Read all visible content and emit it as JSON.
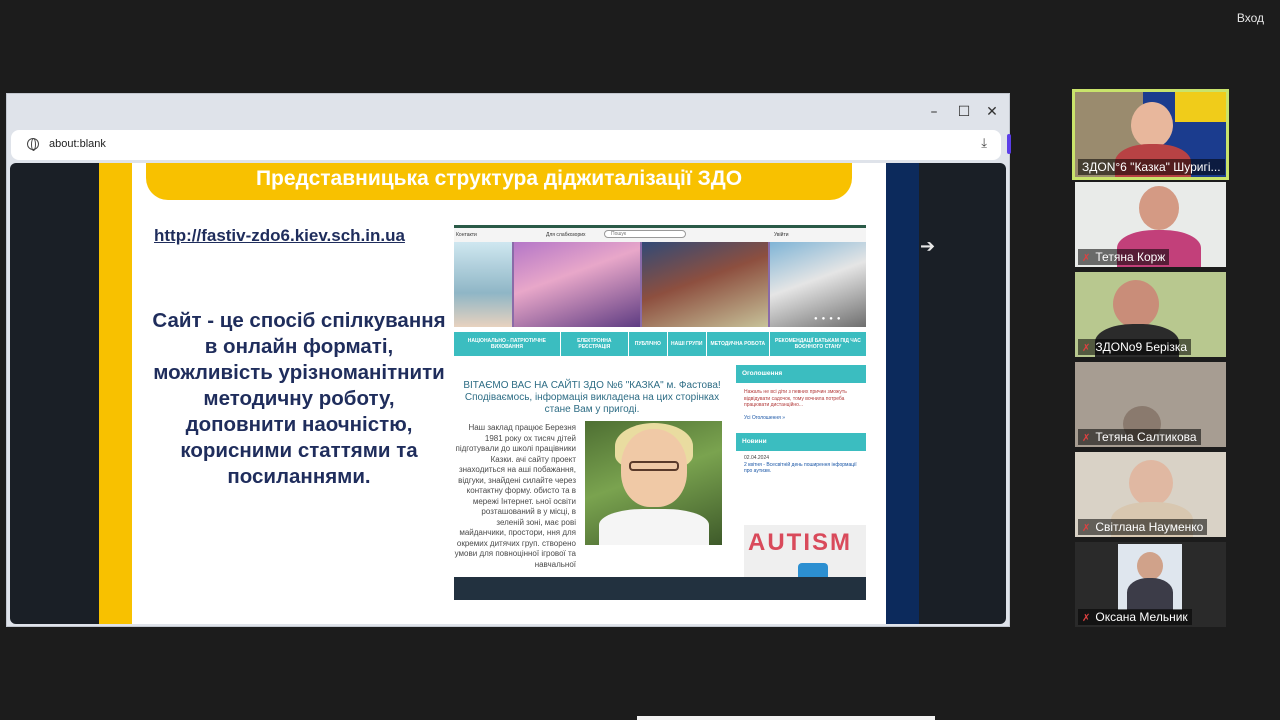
{
  "top_right": {
    "enter_label": "Вход"
  },
  "browser": {
    "url": "about:blank",
    "window_controls": [
      "minimize-icon",
      "maximize-icon",
      "close-icon"
    ]
  },
  "slide": {
    "title": "Представницька структура діджиталізації ЗДО",
    "link": "http://fastiv-zdo6.kiev.sch.in.ua",
    "body": "Сайт -  це   спосіб спілкування в онлайн форматі, можливість урізноманітнити методичну роботу, доповнити наочністю, корисними статтями та посиланнями.",
    "site": {
      "nav": [
        "Контакти",
        "Для слабкозорих",
        "Увійти"
      ],
      "search_placeholder": "Пошук",
      "menu": [
        "НАЦІОНАЛЬНО - ПАТРІОТИЧНЕ ВИХОВАННЯ",
        "ЕЛЕКТРОННА РЕЄСТРАЦІЯ",
        "ПУБЛІЧНО",
        "НАШІ ГРУПИ",
        "МЕТОДИЧНА РОБОТА",
        "РЕКОМЕНДАЦІЇ БАТЬКАМ ПІД ЧАС ВОЄННОГО СТАНУ"
      ],
      "welcome": "ВІТАЄМО ВАС НА САЙТІ ЗДО №6 \"КАЗКА\" м. Фастова! Сподіваємось, інформація викладена на цих сторінках стане Вам у пригоді.",
      "intro": "Наш заклад працює Березня 1981 року ох тисяч дітей підготували до  школі працівники Казки. ачі сайту проект знаходиться на аші побажання, відгуки, знайдені силайте через контактну форму. обисто та в мережі Інтернет. ьної освіти розташований в у місці, в зеленій зоні, має рові майданчики, простори, ння для окремих дитячих груп. створено умови для повноцінної ігрової та навчальної",
      "announcements_title": "Оголошення",
      "announcements_text": "Нажаль не всі діти з певних причин зможуть відвідувати садочок, тому вочнила потреба працювати дистанційно...",
      "announcements_link": "Усі Оголошення »",
      "news_title": "Новини",
      "news_date": "02.04.2024",
      "news_link": "2 квітня - Всесвітній день поширення інформації про аутизм.",
      "news_image_text": "AUTISM"
    }
  },
  "participants": [
    {
      "name": "ЗДОN°6 \"Казка\" Шуригі...",
      "muted": false,
      "active": true
    },
    {
      "name": "Тетяна Корж",
      "muted": true
    },
    {
      "name": "ЗДОNo9 Берізка",
      "muted": true
    },
    {
      "name": "Тетяна Салтикова",
      "muted": true
    },
    {
      "name": "Світлана Науменко",
      "muted": true
    },
    {
      "name": "Оксана Мельник",
      "muted": true
    }
  ],
  "colors": {
    "slide_yellow": "#f8c100",
    "slide_navy": "#0c2a5c",
    "site_teal": "#3bbdc0",
    "active_speaker_border": "#c9e36b",
    "muted_icon": "#e04040"
  }
}
